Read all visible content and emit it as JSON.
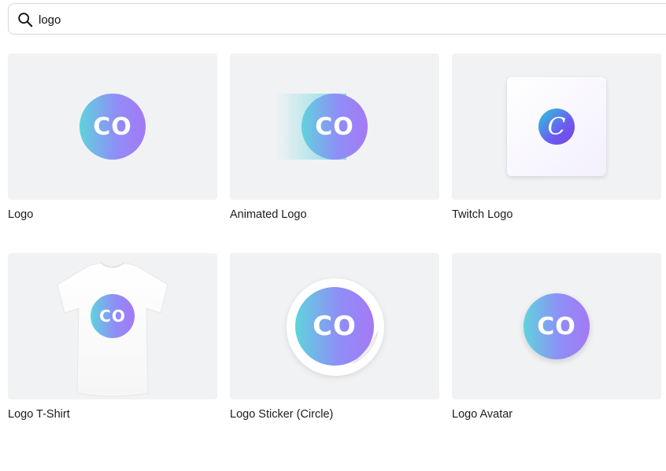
{
  "search": {
    "value": "logo",
    "icon": "search-icon"
  },
  "brand": {
    "logo_text": "CO",
    "twitch_glyph": "C",
    "gradient_start": "#5fd3dc",
    "gradient_end": "#a479f6",
    "thumb_bg": "#f1f2f4"
  },
  "results": [
    {
      "label": "Logo"
    },
    {
      "label": "Animated Logo"
    },
    {
      "label": "Twitch Logo"
    },
    {
      "label": "Logo T-Shirt"
    },
    {
      "label": "Logo Sticker (Circle)"
    },
    {
      "label": "Logo Avatar"
    }
  ]
}
